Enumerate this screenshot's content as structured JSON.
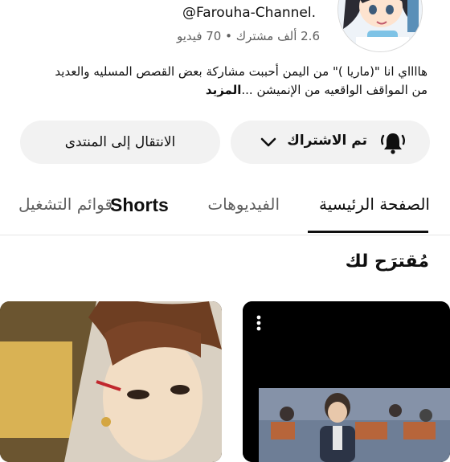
{
  "channel": {
    "handle": "@Farouha-Channel.",
    "stats": "2.6 ألف مشترك • 70 فيديو",
    "description_line1": "هااااي انا \"(ماريا )\" من اليمن أحببت مشاركة بعض القصص المسليه والعديد",
    "description_line2": "من المواقف الواقعيه من الإنميشن ...",
    "more_label": "المزيد"
  },
  "buttons": {
    "subscribed_label": "تم الاشتراك",
    "forum_label": "الانتقال إلى المنتدى"
  },
  "tabs": {
    "home": "الصفحة الرئيسية",
    "videos": "الفيديوهات",
    "shorts": "Shorts",
    "playlists": "قوائم التشغيل"
  },
  "section": {
    "title": "مُقترَح لك"
  },
  "icons": {
    "bell": "bell-ring-icon",
    "chevron": "chevron-down-icon",
    "kebab": "more-vert-icon"
  }
}
